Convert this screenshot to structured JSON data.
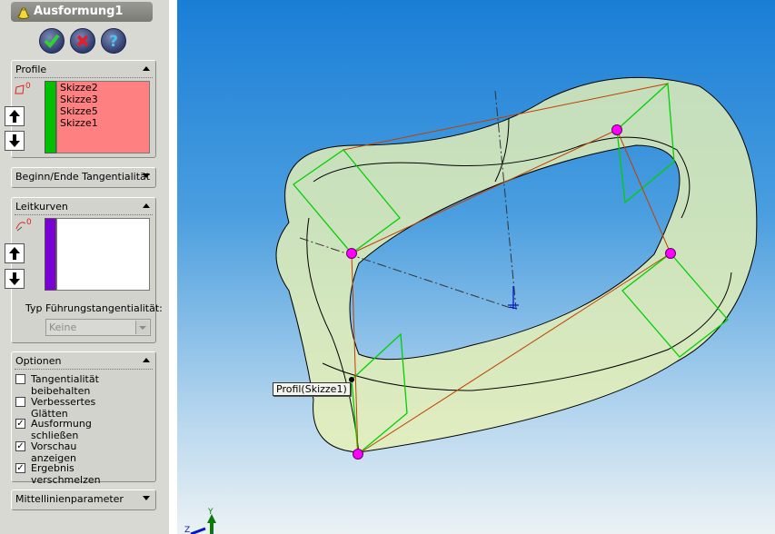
{
  "feature_title": "Ausformung1",
  "buttons": {
    "ok_icon": "check-icon",
    "cancel_icon": "x-icon",
    "help_icon": "question-icon"
  },
  "profile": {
    "header": "Profile",
    "items": [
      "Skizze2",
      "Skizze3",
      "Skizze5",
      "Skizze1"
    ],
    "list_bg": "#ff8080",
    "bar_color": "#00c000"
  },
  "tangency": {
    "header": "Beginn/Ende Tangentialität"
  },
  "guides": {
    "header": "Leitkurven",
    "bar_color": "#7b00d6",
    "tangency_type_label": "Typ Führungstangentialität:",
    "tangency_type_value": "Keine"
  },
  "options": {
    "header": "Optionen",
    "items": [
      {
        "label": "Tangentialität beibehalten",
        "checked": false
      },
      {
        "label": "Verbessertes Glätten",
        "checked": false
      },
      {
        "label": "Ausformung schließen",
        "checked": true
      },
      {
        "label": "Vorschau anzeigen",
        "checked": true
      },
      {
        "label": "Ergebnis verschmelzen",
        "checked": true
      }
    ]
  },
  "centerline": {
    "header": "Mittellinienparameter"
  },
  "viewport": {
    "tooltip": "Profil(Skizze1)",
    "triad_labels": {
      "y": "Y",
      "z": "Z"
    },
    "colors": {
      "surface": "#e6f0b4",
      "section": "#00d000",
      "point": "#ff00ff",
      "guide": "#c04000"
    }
  }
}
